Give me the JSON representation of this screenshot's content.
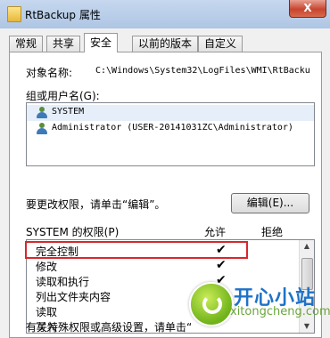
{
  "window": {
    "title": "RtBackup 属性",
    "close_label": "X"
  },
  "tabs": [
    {
      "label": "常规",
      "active": false
    },
    {
      "label": "共享",
      "active": false
    },
    {
      "label": "安全",
      "active": true
    },
    {
      "label": "以前的版本",
      "active": false
    },
    {
      "label": "自定义",
      "active": false
    }
  ],
  "object": {
    "label": "对象名称:",
    "value": "C:\\Windows\\System32\\LogFiles\\WMI\\RtBacku"
  },
  "groups": {
    "label": "组或用户名(G):",
    "items": [
      {
        "name": "SYSTEM",
        "selected": true
      },
      {
        "name": "Administrator (USER-20141031ZC\\Administrator)",
        "selected": false
      }
    ]
  },
  "edit": {
    "hint": "要更改权限，请单击“编辑”。",
    "button_label": "编辑(E)..."
  },
  "permissions": {
    "header_label": "SYSTEM 的权限(P)",
    "allow_label": "允许",
    "deny_label": "拒绝",
    "rows": [
      {
        "name": "完全控制",
        "allow": "✔"
      },
      {
        "name": "修改",
        "allow": "✔"
      },
      {
        "name": "读取和执行",
        "allow": "✔"
      },
      {
        "name": "列出文件夹内容",
        "allow": "✔"
      },
      {
        "name": "读取",
        "allow": "✔"
      },
      {
        "name": "写入",
        "allow": ""
      }
    ]
  },
  "advanced_hint": "有关特殊权限或高级设置，请单击“",
  "watermark": {
    "brand": "开心小站",
    "url": "xitongcheng.com"
  },
  "colors": {
    "highlight": "#d9262c",
    "titlebar": "#aec6e4"
  }
}
